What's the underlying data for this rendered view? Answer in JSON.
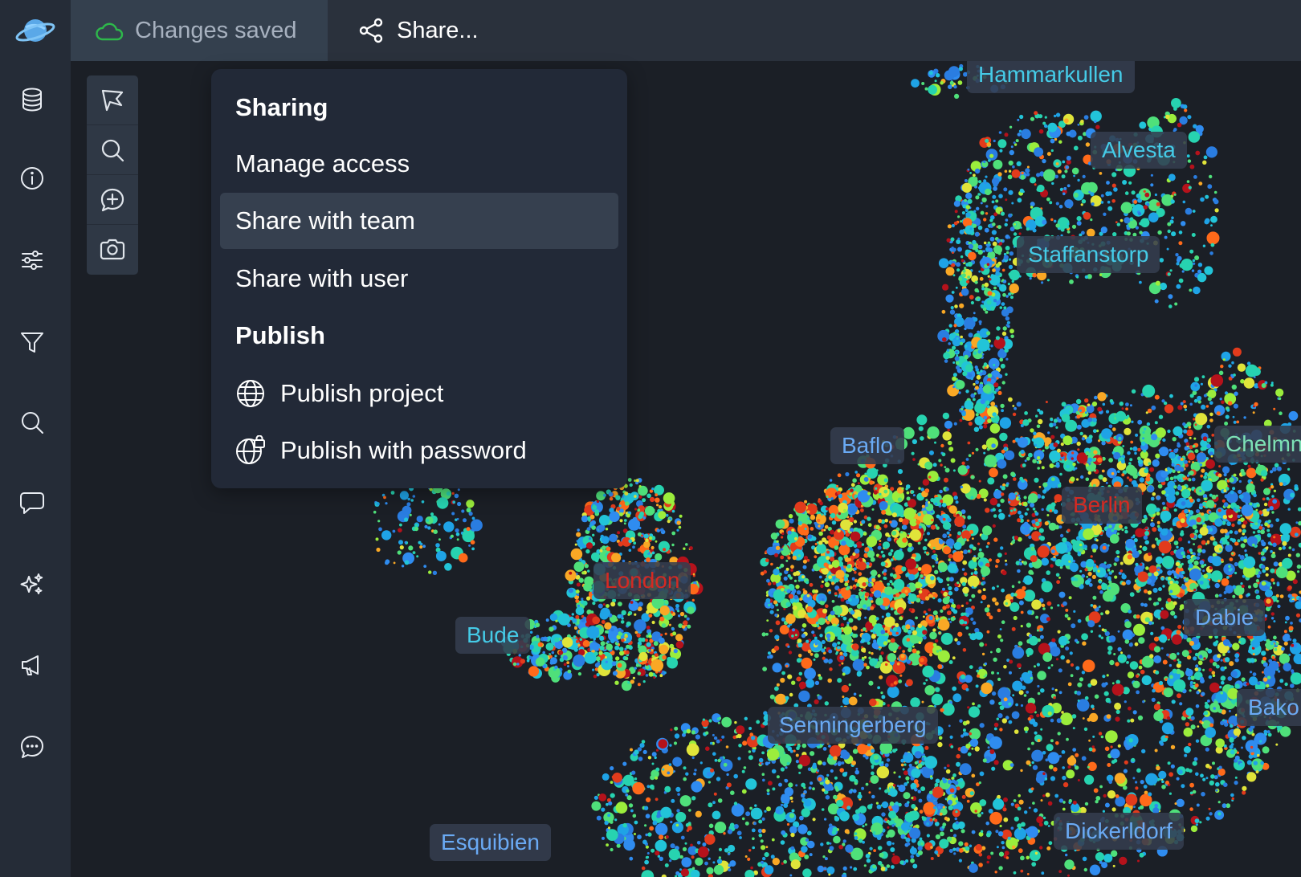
{
  "topbar": {
    "save_status": "Changes saved",
    "share_label": "Share..."
  },
  "sidebar": {
    "items": [
      {
        "icon": "database-icon"
      },
      {
        "icon": "info-icon"
      },
      {
        "icon": "sliders-icon"
      },
      {
        "icon": "filter-icon"
      },
      {
        "icon": "search-icon"
      },
      {
        "icon": "comment-icon"
      },
      {
        "icon": "sparkles-icon"
      },
      {
        "icon": "megaphone-icon"
      },
      {
        "icon": "chat-dots-icon"
      }
    ]
  },
  "map_tools": [
    "lasso-icon",
    "zoom-search-icon",
    "add-comment-icon",
    "camera-icon"
  ],
  "share_menu": {
    "sharing_heading": "Sharing",
    "manage_access": "Manage access",
    "share_with_team": "Share with team",
    "share_with_user": "Share with user",
    "publish_heading": "Publish",
    "publish_project": "Publish project",
    "publish_with_password": "Publish with password"
  },
  "map_labels": {
    "hammarkullen": "Hammarkullen",
    "alvesta": "Alvesta",
    "staffanstorp": "Staffanstorp",
    "baflo": "Baflo",
    "chelmn": "Chelmn",
    "berlin": "Berlin",
    "london": "London",
    "bude": "Bude",
    "dabie": "Dabie",
    "bako": "Bako",
    "senningerberg": "Senningerberg",
    "esquibien": "Esquibien",
    "dickerldorf": "Dickerldorf"
  },
  "colors": {
    "save_icon": "#2eb84b",
    "label_blue": "#6aaaf4",
    "label_cyan": "#45cbe7",
    "label_red": "#d42a23",
    "label_green": "#7de0b5",
    "menu_bg": "#222937",
    "menu_active": "#36404f"
  }
}
